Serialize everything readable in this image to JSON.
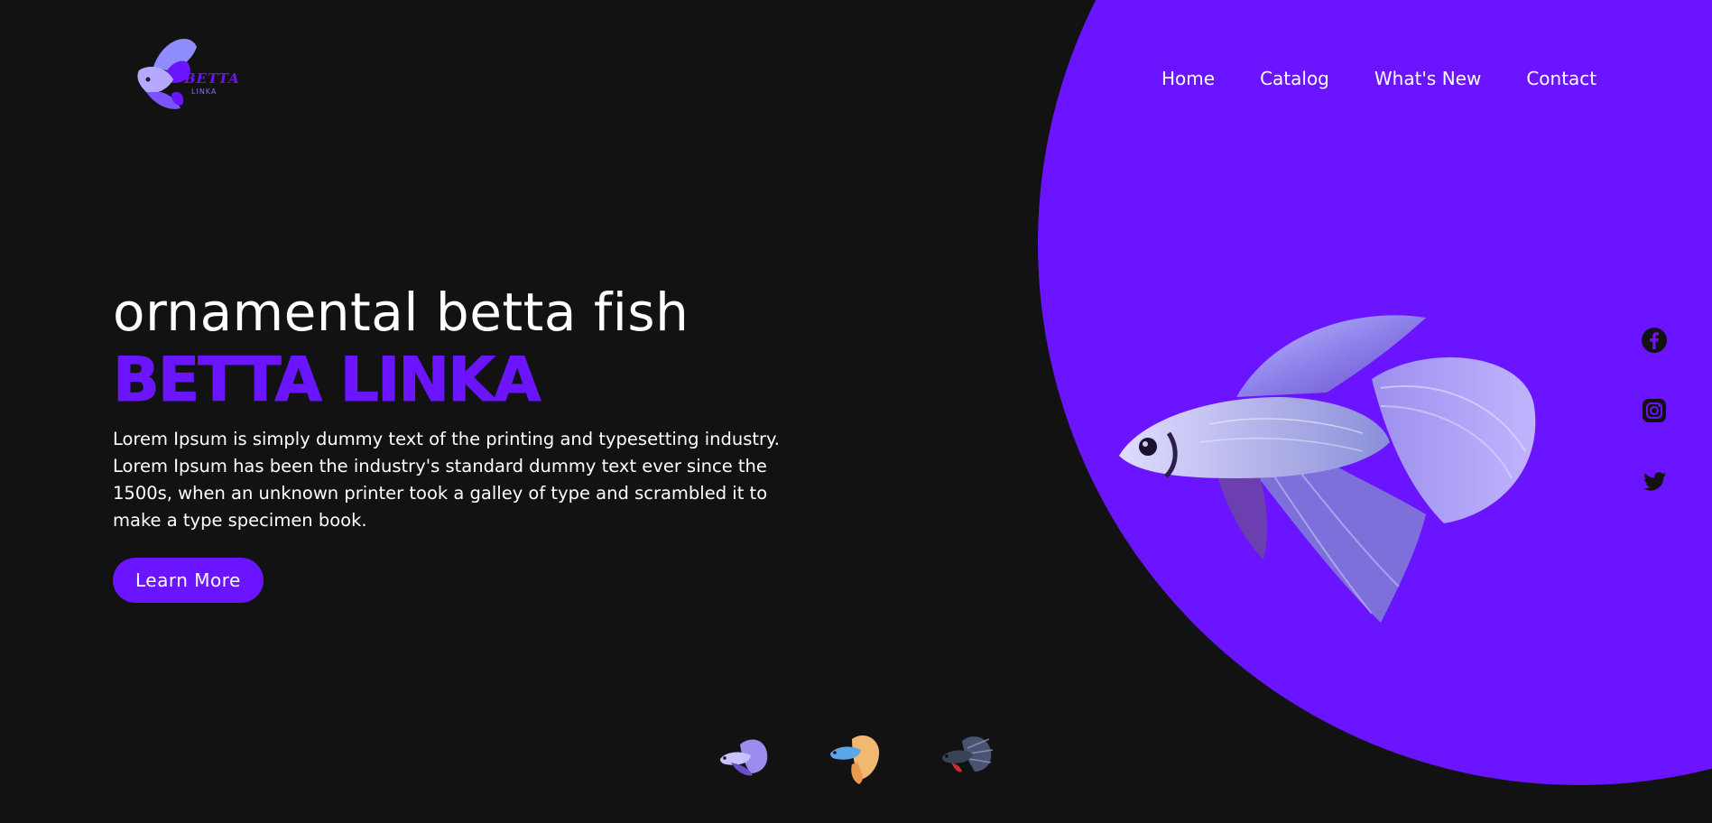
{
  "brand": {
    "logo_text": "BETTA",
    "logo_sub": "LINKA"
  },
  "nav": {
    "items": [
      {
        "label": "Home"
      },
      {
        "label": "Catalog"
      },
      {
        "label": "What's New"
      },
      {
        "label": "Contact"
      }
    ]
  },
  "hero": {
    "subtitle": "ornamental betta fish",
    "title": "BETTA LINKA",
    "description": "Lorem Ipsum is simply dummy text of the printing and typesetting industry. Lorem Ipsum has been the industry's standard dummy text ever since the 1500s, when an unknown printer took a galley of type and scrambled it to make a type specimen book.",
    "cta_label": "Learn More"
  },
  "social": {
    "icons": [
      "facebook-icon",
      "instagram-icon",
      "twitter-icon"
    ]
  },
  "thumbnails": {
    "items": [
      "blue-betta-thumbnail",
      "orange-betta-thumbnail",
      "dark-betta-thumbnail"
    ]
  },
  "colors": {
    "accent": "#6a14ff",
    "background": "#121212",
    "text": "#ffffff"
  }
}
